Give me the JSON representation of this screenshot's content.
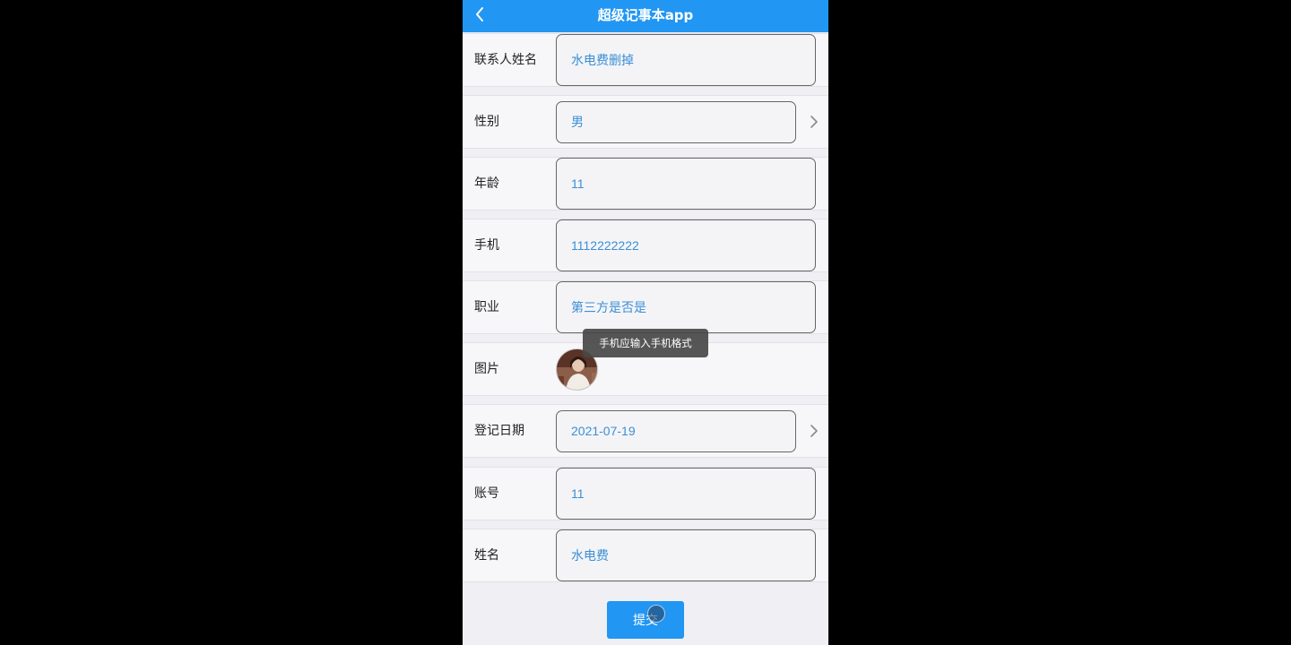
{
  "app": {
    "title": "超级记事本app"
  },
  "nav": {
    "back_icon": "chevron-left-icon"
  },
  "form": {
    "contact_name": {
      "label": "联系人姓名",
      "value": "水电费删掉"
    },
    "gender": {
      "label": "性别",
      "value": "男",
      "icon": "chevron-right-icon"
    },
    "age": {
      "label": "年龄",
      "value": "11"
    },
    "phone": {
      "label": "手机",
      "value": "1112222222"
    },
    "occupation": {
      "label": "职业",
      "value": "第三方是否是"
    },
    "photo": {
      "label": "图片"
    },
    "register_date": {
      "label": "登记日期",
      "value": "2021-07-19",
      "icon": "chevron-right-icon"
    },
    "account": {
      "label": "账号",
      "value": "11"
    },
    "name": {
      "label": "姓名",
      "value": "水电费"
    }
  },
  "toast": {
    "message": "手机应输入手机格式"
  },
  "submit": {
    "label": "提交"
  },
  "colors": {
    "primary": "#2196f3",
    "field_text": "#3a8fd6",
    "background": "#efeff4"
  }
}
